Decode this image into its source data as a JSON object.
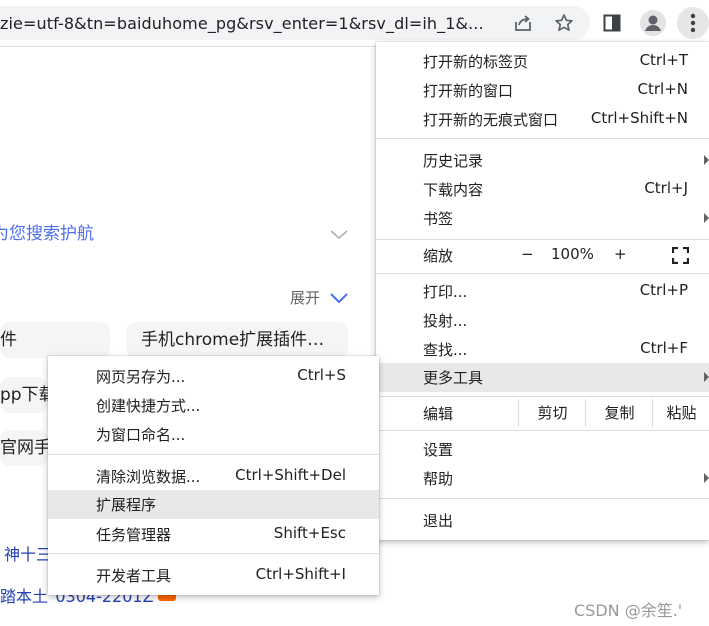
{
  "address_bar": {
    "url_text": "zie=utf-8&tn=baiduhome_pg&rsv_enter=1&rsv_dl=ih_1&..."
  },
  "page": {
    "nav_text": "为您搜索护航",
    "expand_label": "展开",
    "chips": [
      "件",
      "手机chrome扩展插件…",
      "pp下载",
      "官网手机"
    ],
    "links": [
      "神十三",
      "踏本土\"0304-2201Z"
    ],
    "watermark": "CSDN @余笙.'"
  },
  "main_menu": {
    "new_tab": {
      "label": "打开新的标签页",
      "shortcut": "Ctrl+T"
    },
    "new_window": {
      "label": "打开新的窗口",
      "shortcut": "Ctrl+N"
    },
    "incognito": {
      "label": "打开新的无痕式窗口",
      "shortcut": "Ctrl+Shift+N"
    },
    "history": {
      "label": "历史记录"
    },
    "downloads": {
      "label": "下载内容",
      "shortcut": "Ctrl+J"
    },
    "bookmarks": {
      "label": "书签"
    },
    "zoom": {
      "label": "缩放",
      "minus": "−",
      "level": "100%",
      "plus": "+"
    },
    "print": {
      "label": "打印...",
      "shortcut": "Ctrl+P"
    },
    "cast": {
      "label": "投射..."
    },
    "find": {
      "label": "查找...",
      "shortcut": "Ctrl+F"
    },
    "more_tools": {
      "label": "更多工具"
    },
    "edit": {
      "label": "编辑",
      "cut": "剪切",
      "copy": "复制",
      "paste": "粘贴"
    },
    "settings": {
      "label": "设置"
    },
    "help": {
      "label": "帮助"
    },
    "exit": {
      "label": "退出"
    }
  },
  "sub_menu": {
    "save_page": {
      "label": "网页另存为...",
      "shortcut": "Ctrl+S"
    },
    "create_shortcut": {
      "label": "创建快捷方式..."
    },
    "name_window": {
      "label": "为窗口命名..."
    },
    "clear_data": {
      "label": "清除浏览数据...",
      "shortcut": "Ctrl+Shift+Del"
    },
    "extensions": {
      "label": "扩展程序"
    },
    "task_manager": {
      "label": "任务管理器",
      "shortcut": "Shift+Esc"
    },
    "dev_tools": {
      "label": "开发者工具",
      "shortcut": "Ctrl+Shift+I"
    }
  },
  "colors": {
    "accent": "#4e6ef2",
    "link": "#2440b3",
    "hover": "#e8e8e8"
  }
}
